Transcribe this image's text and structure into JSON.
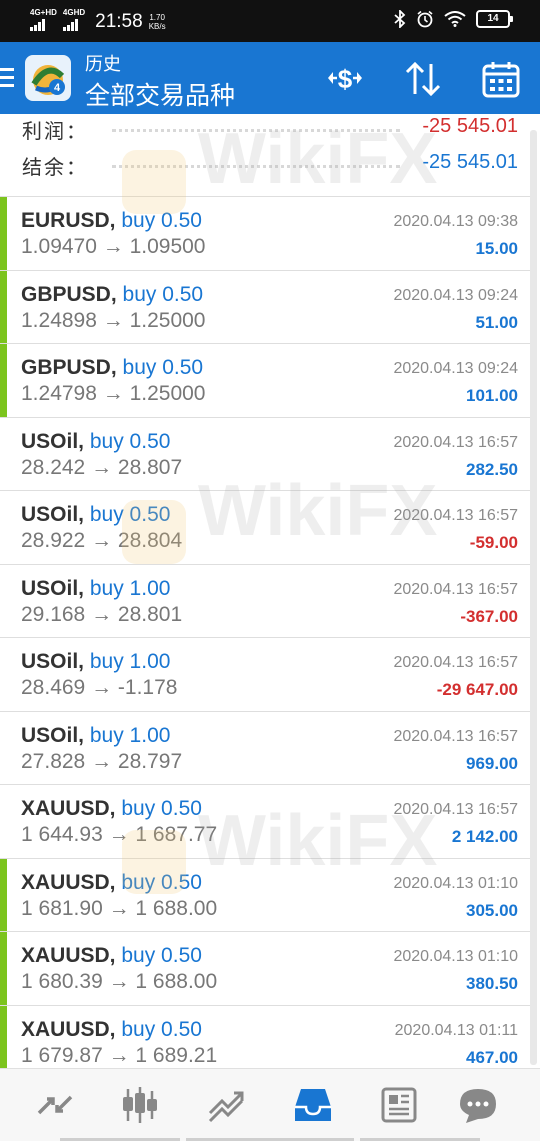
{
  "status_bar": {
    "net1": "4G+HD",
    "net2": "4GHD",
    "time": "21:58",
    "speed_value": "1.70",
    "speed_unit": "KB/s",
    "battery": "14"
  },
  "header": {
    "title": "历史",
    "subtitle": "全部交易品种"
  },
  "summary": {
    "profit_label": "利润：",
    "profit_value": "-25 545.01",
    "balance_label": "结余：",
    "balance_value": "-25 545.01"
  },
  "trades": [
    {
      "symbol": "EURUSD,",
      "side": "buy 0.50",
      "prices": "1.09470 → 1.09500",
      "time": "2020.04.13 09:38",
      "profit": "15.00",
      "profit_color": "#1976d2",
      "accent": true
    },
    {
      "symbol": "GBPUSD,",
      "side": "buy 0.50",
      "prices": "1.24898 → 1.25000",
      "time": "2020.04.13 09:24",
      "profit": "51.00",
      "profit_color": "#1976d2",
      "accent": true
    },
    {
      "symbol": "GBPUSD,",
      "side": "buy 0.50",
      "prices": "1.24798 → 1.25000",
      "time": "2020.04.13 09:24",
      "profit": "101.00",
      "profit_color": "#1976d2",
      "accent": true
    },
    {
      "symbol": "USOil,",
      "side": "buy 0.50",
      "prices": "28.242 → 28.807",
      "time": "2020.04.13 16:57",
      "profit": "282.50",
      "profit_color": "#1976d2",
      "accent": false
    },
    {
      "symbol": "USOil,",
      "side": "buy 0.50",
      "prices": "28.922 → 28.804",
      "time": "2020.04.13 16:57",
      "profit": "-59.00",
      "profit_color": "#d32f2f",
      "accent": false
    },
    {
      "symbol": "USOil,",
      "side": "buy 1.00",
      "prices": "29.168 → 28.801",
      "time": "2020.04.13 16:57",
      "profit": "-367.00",
      "profit_color": "#d32f2f",
      "accent": false
    },
    {
      "symbol": "USOil,",
      "side": "buy 1.00",
      "prices": "28.469 → -1.178",
      "time": "2020.04.13 16:57",
      "profit": "-29 647.00",
      "profit_color": "#d32f2f",
      "accent": false
    },
    {
      "symbol": "USOil,",
      "side": "buy 1.00",
      "prices": "27.828 → 28.797",
      "time": "2020.04.13 16:57",
      "profit": "969.00",
      "profit_color": "#1976d2",
      "accent": false
    },
    {
      "symbol": "XAUUSD,",
      "side": "buy 0.50",
      "prices": "1 644.93 → 1 687.77",
      "time": "2020.04.13 16:57",
      "profit": "2 142.00",
      "profit_color": "#1976d2",
      "accent": false
    },
    {
      "symbol": "XAUUSD,",
      "side": "buy 0.50",
      "prices": "1 681.90 → 1 688.00",
      "time": "2020.04.13 01:10",
      "profit": "305.00",
      "profit_color": "#1976d2",
      "accent": true
    },
    {
      "symbol": "XAUUSD,",
      "side": "buy 0.50",
      "prices": "1 680.39 → 1 688.00",
      "time": "2020.04.13 01:10",
      "profit": "380.50",
      "profit_color": "#1976d2",
      "accent": true
    },
    {
      "symbol": "XAUUSD,",
      "side": "buy 0.50",
      "prices": "1 679.87 → 1 689.21",
      "time": "2020.04.13 01:11",
      "profit": "467.00",
      "profit_color": "#1976d2",
      "accent": true
    }
  ],
  "watermark": "WikiFX",
  "colors": {
    "header_bg": "#1976d2",
    "accent_bar": "#7cc41e",
    "profit_positive": "#1976d2",
    "profit_negative": "#d32f2f"
  },
  "bottom_nav": [
    {
      "name": "quotes-icon",
      "active": false
    },
    {
      "name": "chart-icon",
      "active": false
    },
    {
      "name": "trade-icon",
      "active": false
    },
    {
      "name": "history-icon",
      "active": true
    },
    {
      "name": "news-icon",
      "active": false
    },
    {
      "name": "chat-icon",
      "active": false
    }
  ]
}
